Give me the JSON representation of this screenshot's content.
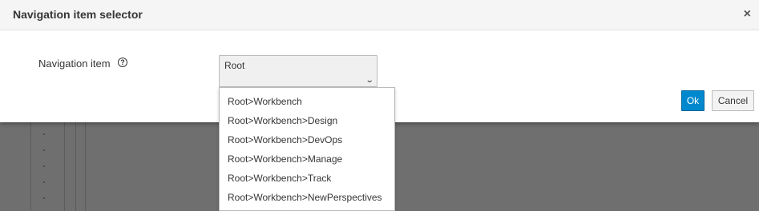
{
  "modal": {
    "title": "Navigation item selector",
    "close_glyph": "×",
    "field_label": "Navigation item",
    "help_icon": "question-circle-icon",
    "select_value": "Root",
    "chevron_glyph": "⌄",
    "ok_label": "Ok",
    "cancel_label": "Cancel"
  },
  "dropdown": {
    "items": [
      "Root>Workbench",
      "Root>Workbench>Design",
      "Root>Workbench>DevOps",
      "Root>Workbench>Manage",
      "Root>Workbench>Track",
      "Root>Workbench>NewPerspectives"
    ]
  },
  "colors": {
    "primary": "#0088ce",
    "overlay": "#6f6f6f",
    "text": "#363636"
  }
}
